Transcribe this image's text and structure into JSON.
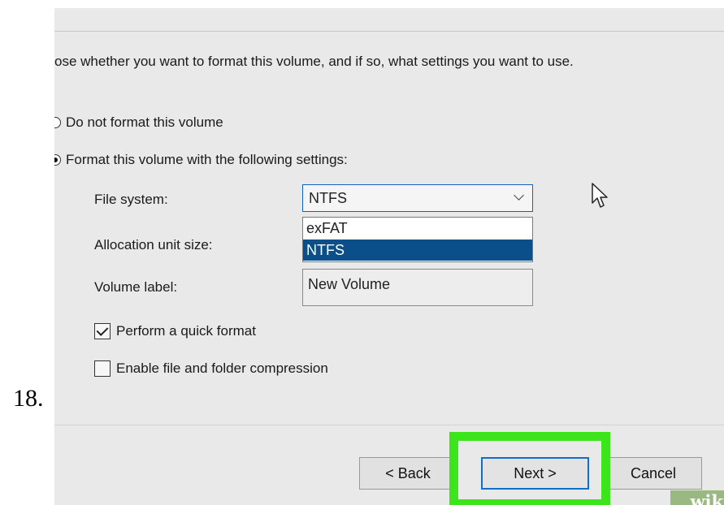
{
  "step_number": "18.",
  "instruction": "ose whether you want to format this volume, and if so, what settings you want to use.",
  "options": {
    "no_format_label": "Do not format this volume",
    "format_label": "Format this volume with the following settings:",
    "selected": "format"
  },
  "settings": {
    "file_system_label": "File system:",
    "file_system_value": "NTFS",
    "file_system_options": [
      "exFAT",
      "NTFS"
    ],
    "allocation_label": "Allocation unit size:",
    "volume_label_label": "Volume label:",
    "volume_label_value": "New Volume",
    "quick_format_label": "Perform a quick format",
    "quick_format_checked": true,
    "compression_label": "Enable file and folder compression",
    "compression_checked": false
  },
  "buttons": {
    "back": "< Back",
    "next": "Next >",
    "cancel": "Cancel"
  },
  "colors": {
    "highlight": "#3ce41c",
    "selected_option": "#0a4f8a",
    "focus_border": "#0f6fca"
  },
  "watermark": "wikiHow"
}
